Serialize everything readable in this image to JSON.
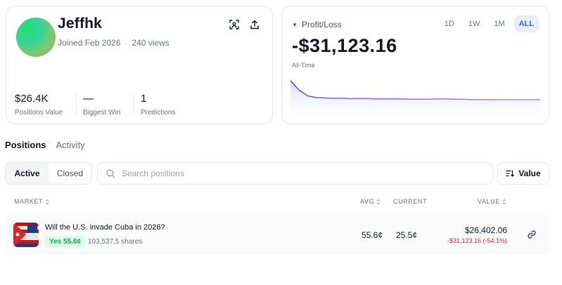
{
  "profile": {
    "username": "Jeffhk",
    "joined": "Joined Feb 2026",
    "views": "240 views",
    "stats": [
      {
        "value": "$26.4K",
        "label": "Positions Value"
      },
      {
        "value": "—",
        "label": "Biggest Win"
      },
      {
        "value": "1",
        "label": "Predictions"
      }
    ],
    "actions": {
      "scan_icon": "scan-icon",
      "share_icon": "share-icon"
    }
  },
  "pnl": {
    "label": "Profit/Loss",
    "value": "-$31,123.16",
    "period": "All-Time",
    "ranges": [
      "1D",
      "1W",
      "1M",
      "ALL"
    ],
    "active_range": "ALL",
    "series": [
      1.0,
      0.72,
      0.55,
      0.5,
      0.49,
      0.48,
      0.48,
      0.47,
      0.47,
      0.47,
      0.46,
      0.46,
      0.46,
      0.46,
      0.45,
      0.45,
      0.45,
      0.46,
      0.46,
      0.45,
      0.45,
      0.44,
      0.44,
      0.44,
      0.44,
      0.44,
      0.44,
      0.44,
      0.44,
      0.44
    ],
    "colors": {
      "line": "#8b5cf6",
      "line_start": "#4f46e5",
      "fill": "#e0e7ff"
    }
  },
  "tabs": {
    "positions": "Positions",
    "activity": "Activity"
  },
  "filter": {
    "active": "Active",
    "closed": "Closed"
  },
  "search": {
    "placeholder": "Search positions"
  },
  "sort": {
    "label": "Value"
  },
  "table": {
    "headers": {
      "market": "MARKET",
      "avg": "AVG",
      "current": "CURRENT",
      "value": "VALUE"
    },
    "rows": [
      {
        "market": "Will the U.S. invade Cuba in 2026?",
        "outcome": "Yes 55.6¢",
        "shares": "103,537.5 shares",
        "avg": "55.6¢",
        "current": "25.5¢",
        "value": "$26,402.06",
        "pnl": "-$31,123.16 (-54.1%)"
      }
    ]
  },
  "colors": {
    "accent": "#3b66d6",
    "positive": "#16a34a",
    "negative": "#dc2626"
  }
}
